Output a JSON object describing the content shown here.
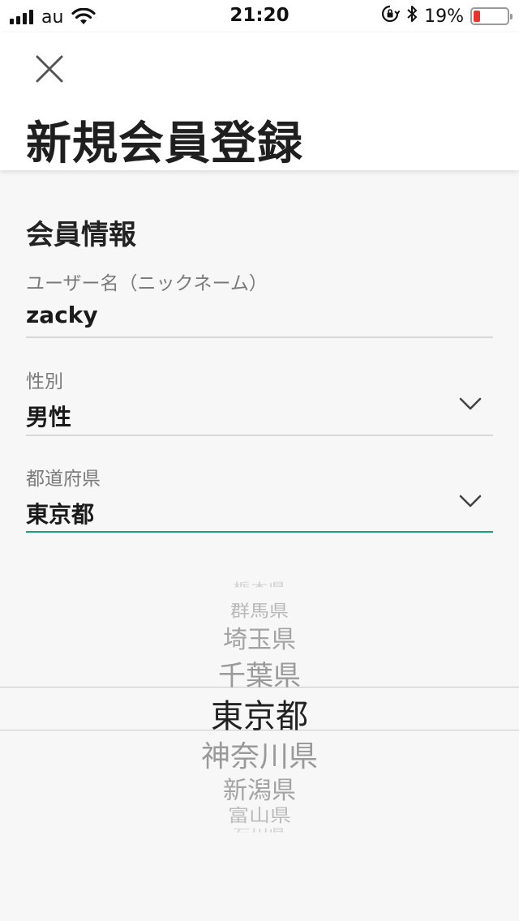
{
  "status_bar": {
    "carrier": "au",
    "time": "21:20",
    "battery_percent": "19%",
    "battery_level": 0.19,
    "battery_color": "#e8332a"
  },
  "header": {
    "title": "新規会員登録",
    "close_icon": "close-icon"
  },
  "form": {
    "section_title": "会員情報",
    "username": {
      "label": "ユーザー名（ニックネーム）",
      "value": "zacky"
    },
    "gender": {
      "label": "性別",
      "value": "男性"
    },
    "prefecture": {
      "label": "都道府県",
      "value": "東京都"
    },
    "accent_color": "#1aa37a"
  },
  "picker": {
    "items": [
      "栃木県",
      "群馬県",
      "埼玉県",
      "千葉県",
      "東京都",
      "神奈川県",
      "新潟県",
      "富山県",
      "石川県"
    ],
    "selected": "東京都"
  }
}
